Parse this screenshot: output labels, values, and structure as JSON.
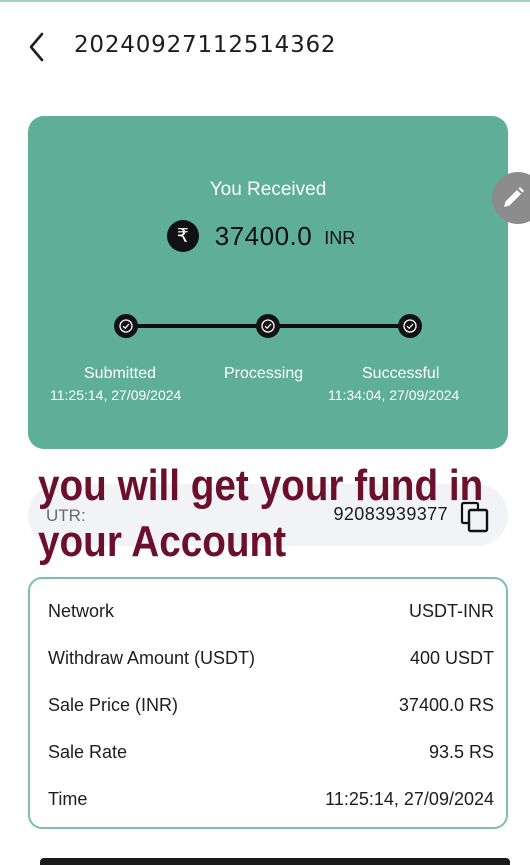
{
  "header": {
    "title": "20240927112514362"
  },
  "card": {
    "received_label": "You Received",
    "amount": "37400.0",
    "currency": "INR",
    "steps": [
      {
        "label": "Submitted",
        "time": "11:25:14, 27/09/2024"
      },
      {
        "label": "Processing",
        "time": ""
      },
      {
        "label": "Successful",
        "time": "11:34:04, 27/09/2024"
      }
    ]
  },
  "utr": {
    "label": "UTR:",
    "value": "92083939377"
  },
  "overlay": {
    "line1": "you will get your fund in",
    "line2": "your Account"
  },
  "details": {
    "rows": [
      {
        "label": "Network",
        "value": "USDT-INR"
      },
      {
        "label": "Withdraw Amount (USDT)",
        "value": "400 USDT"
      },
      {
        "label": "Sale Price (INR)",
        "value": "37400.0 RS"
      },
      {
        "label": "Sale Rate",
        "value": "93.5 RS"
      },
      {
        "label": "Time",
        "value": "11:25:14, 27/09/2024"
      }
    ]
  },
  "colors": {
    "card_green": "#5fae98",
    "overlay_text": "#6b0f2b",
    "details_border": "#7cbfae"
  },
  "icons": [
    "chevron-left-icon",
    "rupee-icon",
    "check-circle-icon",
    "pencil-icon",
    "copy-icon"
  ]
}
